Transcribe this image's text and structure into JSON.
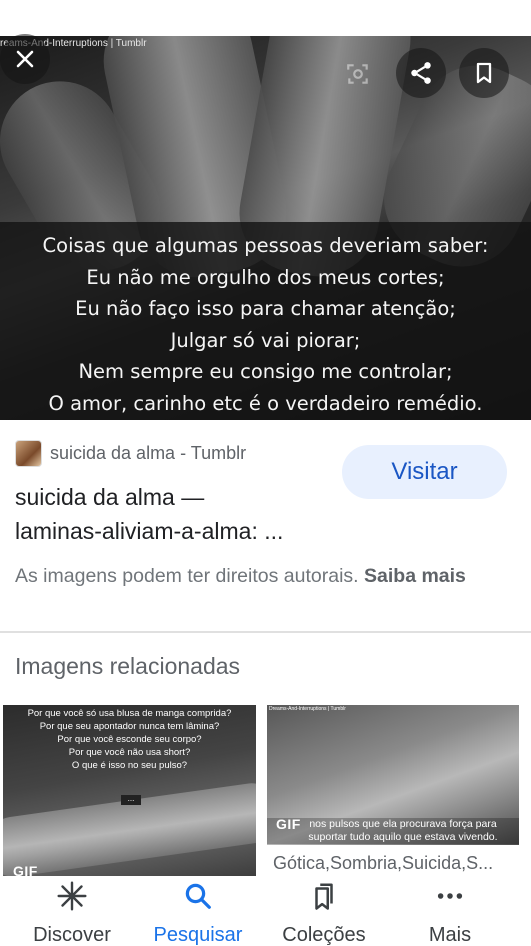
{
  "hero": {
    "watermark": "reams-And-Interruptions | Tumblr",
    "caption_lines": [
      "Coisas que algumas pessoas deveriam saber:",
      "Eu não me orgulho dos meus cortes;",
      "Eu não faço isso para chamar atenção;",
      "Julgar só vai piorar;",
      "Nem sempre eu consigo me controlar;",
      "O amor, carinho etc é o verdadeiro remédio."
    ]
  },
  "result": {
    "source_name": "suicida da alma - Tumblr",
    "visit_label": "Visitar",
    "title_line1": "suicida da alma —",
    "title_line2": "laminas-aliviam-a-alma: ...",
    "copyright_text": "As imagens podem ter direitos autorais.",
    "copyright_link": "Saiba mais"
  },
  "related": {
    "heading": "Imagens relacionadas",
    "items": [
      {
        "text_lines": [
          "Por que você só usa blusa de manga comprida?",
          "Por que seu apontador nunca tem lâmina?",
          "Por que você esconde seu corpo?",
          "Por que você não usa short?",
          "O que é isso no seu pulso?"
        ],
        "dots": "...",
        "badge": "GIF"
      },
      {
        "watermark": "Dreams-And-Interruptions | Tumblr",
        "text_lines": [
          "nos pulsos que ela procurava força para",
          "suportar tudo aquilo que estava vivendo."
        ],
        "badge": "GIF",
        "label": "Gótica,Sombria,Suicida,S..."
      }
    ]
  },
  "nav": {
    "items": [
      {
        "label": "Discover",
        "icon": "asterisk-icon"
      },
      {
        "label": "Pesquisar",
        "icon": "search-icon",
        "active": true
      },
      {
        "label": "Coleções",
        "icon": "collections-icon"
      },
      {
        "label": "Mais",
        "icon": "more-horizontal-icon"
      }
    ]
  },
  "colors": {
    "accent": "#1a73e8",
    "visit_bg": "#e8f0fe",
    "visit_text": "#1a56c4",
    "secondary_text": "#5f6368"
  }
}
